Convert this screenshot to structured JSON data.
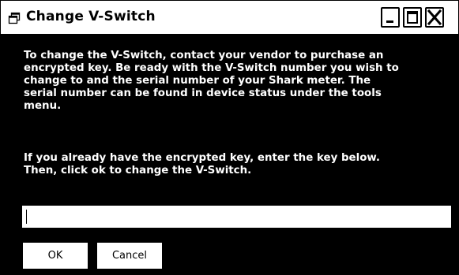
{
  "window": {
    "title": "Change V-Switch",
    "icon": "window-icon",
    "controls": {
      "minimize_icon": "minimize-icon",
      "maximize_icon": "maximize-icon",
      "close_icon": "close-icon"
    }
  },
  "message": {
    "paragraph1": [
      "To change the V-Switch, contact your vendor to purchase an",
      "encrypted key.  Be ready with the V-Switch number you wish to",
      "change to and the serial number of your Shark meter.   The",
      "serial number can be found in device status under the tools",
      "menu."
    ],
    "paragraph2": [
      "If you already have the encrypted key, enter the key below.",
      "Then, click ok to change the V-Switch."
    ]
  },
  "key_field": {
    "value": "",
    "placeholder": ""
  },
  "buttons": {
    "ok_label": "OK",
    "cancel_label": "Cancel"
  },
  "colors": {
    "dialog_background": "#000000",
    "dialog_text": "#ffffff",
    "titlebar_background": "#ffffff",
    "titlebar_text": "#000000"
  }
}
